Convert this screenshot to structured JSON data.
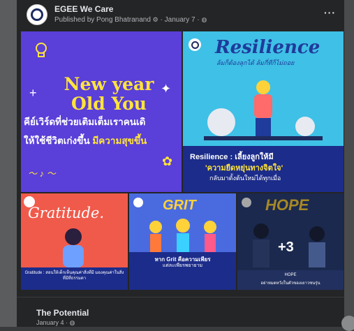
{
  "post": {
    "page_name": "EGEE We Care",
    "published_by": "Published by Pong Bhatranand",
    "date": "January 7",
    "more": "···"
  },
  "tiles": {
    "t1": {
      "headline_line1": "New year",
      "headline_line2": "Old You",
      "thai_line1": "คีย์เวิร์ดที่ช่วยเติมเต็มเราคนเดิ",
      "thai_line2_a": "ให้ใช้ชีวิตเก่งขึ้น",
      "thai_line2_b": "มีความสุขขึ้น"
    },
    "t2": {
      "title": "Resilience",
      "subtitle": "ล้มก็ต้องลุกได้ ล้มกี่ทีก็ไม่ถอย",
      "caption1": "Resilience : เลี้ยงลูกให้มี",
      "caption2": "'ความยืดหยุ่นทางจิตใจ'",
      "caption3": "กลับมาตั้งต้นใหม่ได้ทุกเมื่อ"
    },
    "t3": {
      "title": "Gratitude.",
      "caption": "Gratitude : สอนให้เด็กเห็นคุณค่าสิ่งที่มี มองคุณค่าในสิ่งที่มีที่ธรรมดา"
    },
    "t4": {
      "title": "GRIT",
      "caption1": "หาก Grit คือความเพียร",
      "caption2": "แต่ละเพียรพยายาม"
    },
    "t5": {
      "title": "HOPE",
      "more_count": "+3",
      "caption1": "HOPE",
      "caption2": "อย่าหมดหวังในตัวของเยาวชนรุ่น"
    }
  },
  "next_post": {
    "title": "The Potential",
    "date": "January 4"
  }
}
